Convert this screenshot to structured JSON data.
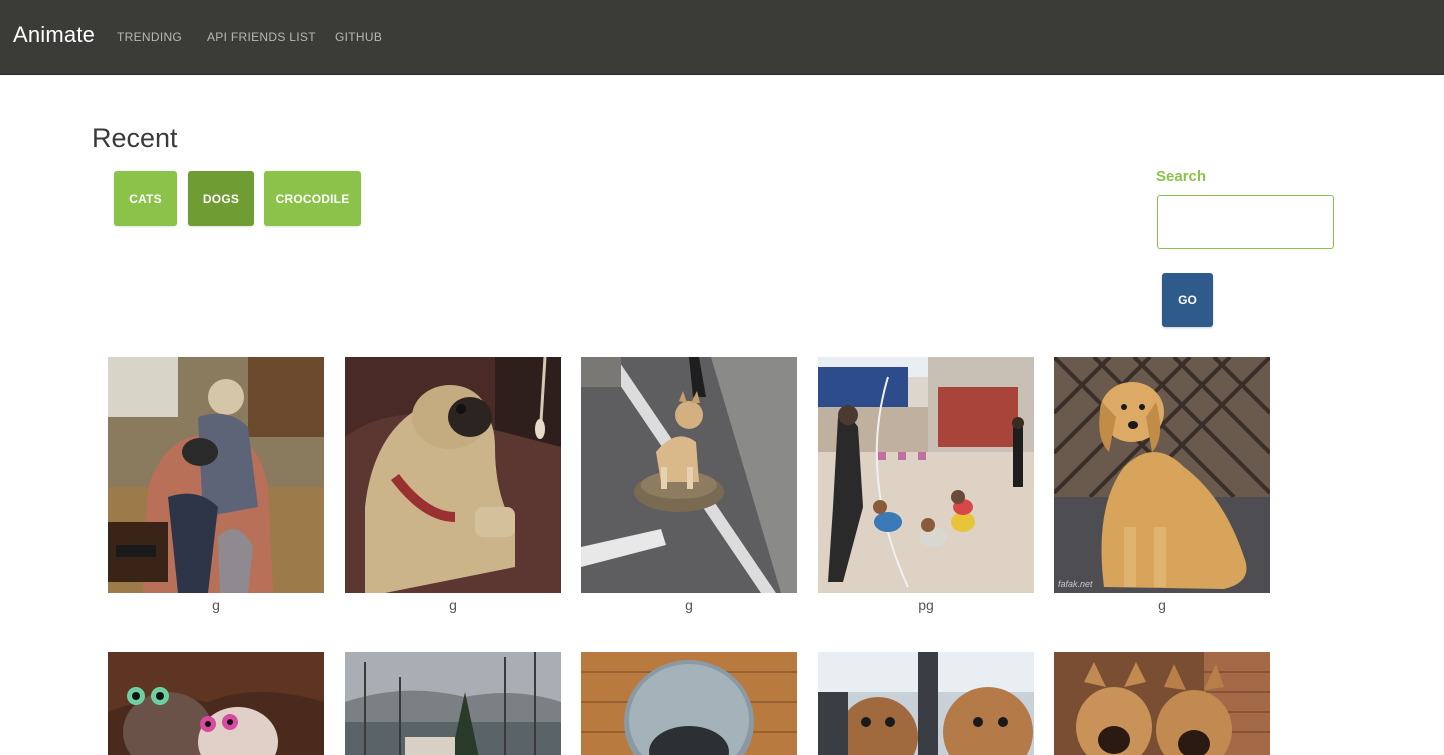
{
  "navbar": {
    "brand": "Animate",
    "links": [
      "TRENDING",
      "API FRIENDS LIST",
      "GITHUB"
    ]
  },
  "recent": {
    "title": "Recent",
    "categories": [
      {
        "label": "CATS",
        "active": false
      },
      {
        "label": "DOGS",
        "active": true
      },
      {
        "label": "CROCODILE",
        "active": false
      }
    ]
  },
  "search": {
    "label": "Search",
    "value": "",
    "placeholder": "",
    "go_label": "GO"
  },
  "gifs": {
    "row1": [
      {
        "caption": "g",
        "subject": "woman-with-dog-in-chair"
      },
      {
        "caption": "g",
        "subject": "pug-on-couch"
      },
      {
        "caption": "g",
        "subject": "shiba-riding-tortoise"
      },
      {
        "caption": "pg",
        "subject": "man-walking-dogs-jump-rope"
      },
      {
        "caption": "g",
        "subject": "golden-retriever-sitting",
        "watermark": "fafak.net"
      }
    ],
    "row2": [
      {
        "subject": "dogs-with-googly-eye-glasses"
      },
      {
        "subject": "winter-trees-landscape"
      },
      {
        "subject": "dog-in-pod-bed"
      },
      {
        "subject": "two-dogs-in-car"
      },
      {
        "subject": "two-shepherd-dogs"
      }
    ]
  },
  "colors": {
    "navbar": "#3b3b38",
    "accent_green": "#8bc34a",
    "active_green": "#6f9d34",
    "go_blue": "#2e5b8c"
  }
}
